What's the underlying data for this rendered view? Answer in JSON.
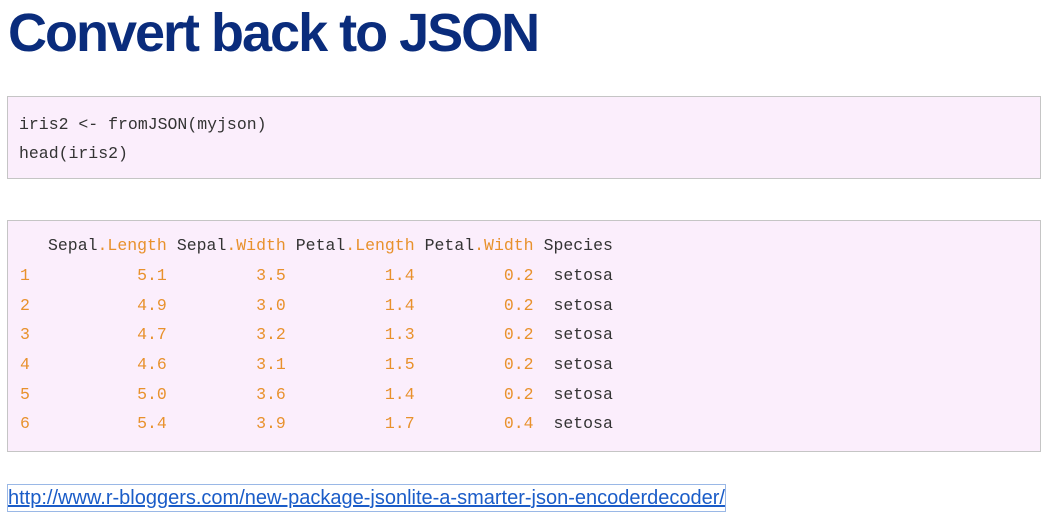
{
  "title": "Convert back to JSON",
  "code": {
    "lines": [
      "iris2 <- fromJSON(myjson)",
      "head(iris2)"
    ]
  },
  "output": {
    "columns": [
      {
        "name": "Sepal",
        "sep": ".",
        "suffix": "Length"
      },
      {
        "name": "Sepal",
        "sep": ".",
        "suffix": "Width"
      },
      {
        "name": "Petal",
        "sep": ".",
        "suffix": "Length"
      },
      {
        "name": "Petal",
        "sep": ".",
        "suffix": "Width"
      },
      {
        "name": "Species",
        "sep": "",
        "suffix": ""
      }
    ],
    "rows": [
      {
        "n": "1",
        "sl": "5.1",
        "sw": "3.5",
        "pl": "1.4",
        "pw": "0.2",
        "species": "setosa"
      },
      {
        "n": "2",
        "sl": "4.9",
        "sw": "3.0",
        "pl": "1.4",
        "pw": "0.2",
        "species": "setosa"
      },
      {
        "n": "3",
        "sl": "4.7",
        "sw": "3.2",
        "pl": "1.3",
        "pw": "0.2",
        "species": "setosa"
      },
      {
        "n": "4",
        "sl": "4.6",
        "sw": "3.1",
        "pl": "1.5",
        "pw": "0.2",
        "species": "setosa"
      },
      {
        "n": "5",
        "sl": "5.0",
        "sw": "3.6",
        "pl": "1.4",
        "pw": "0.2",
        "species": "setosa"
      },
      {
        "n": "6",
        "sl": "5.4",
        "sw": "3.9",
        "pl": "1.7",
        "pw": "0.4",
        "species": "setosa"
      }
    ]
  },
  "link": {
    "text": "http://www.r-bloggers.com/new-package-jsonlite-a-smarter-json-encoderdecoder/",
    "href": "http://www.r-bloggers.com/new-package-jsonlite-a-smarter-json-encoderdecoder/"
  },
  "colors": {
    "title": "#0a2c7c",
    "code_bg": "#fbeefc",
    "accent_orange": "#e8912c",
    "link": "#1a5cc8"
  }
}
